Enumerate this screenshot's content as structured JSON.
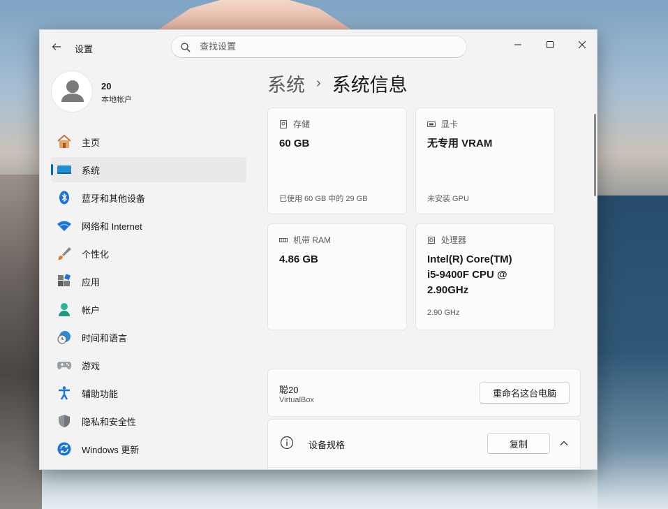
{
  "window": {
    "title": "设置",
    "search_placeholder": "查找设置"
  },
  "profile": {
    "name": "20",
    "account_type": "本地帐户"
  },
  "nav": [
    {
      "label": "主页",
      "icon": "home-icon",
      "active": false
    },
    {
      "label": "系统",
      "icon": "system-icon",
      "active": true
    },
    {
      "label": "蓝牙和其他设备",
      "icon": "bluetooth-icon",
      "active": false
    },
    {
      "label": "网络和 Internet",
      "icon": "wifi-icon",
      "active": false
    },
    {
      "label": "个性化",
      "icon": "brush-icon",
      "active": false
    },
    {
      "label": "应用",
      "icon": "apps-icon",
      "active": false
    },
    {
      "label": "帐户",
      "icon": "account-icon",
      "active": false
    },
    {
      "label": "时间和语言",
      "icon": "globe-clock-icon",
      "active": false
    },
    {
      "label": "游戏",
      "icon": "gamepad-icon",
      "active": false
    },
    {
      "label": "辅助功能",
      "icon": "accessibility-icon",
      "active": false
    },
    {
      "label": "隐私和安全性",
      "icon": "shield-icon",
      "active": false
    },
    {
      "label": "Windows 更新",
      "icon": "update-icon",
      "active": false
    }
  ],
  "breadcrumb": {
    "parent": "系统",
    "separator": "›",
    "current": "系统信息"
  },
  "cards": {
    "storage": {
      "title": "存储",
      "value": "60 GB",
      "footer": "已使用 60 GB 中的 29 GB"
    },
    "gpu": {
      "title": "显卡",
      "value": "无专用 VRAM",
      "footer": "未安装 GPU"
    },
    "ram": {
      "title": "机带 RAM",
      "value": "4.86 GB"
    },
    "cpu": {
      "title": "处理器",
      "value_line1": "Intel(R) Core(TM)",
      "value_line2": "i5-9400F CPU @",
      "value_line3": "2.90GHz",
      "footer": "2.90 GHz"
    }
  },
  "pc": {
    "name": "聪20",
    "model": "VirtualBox",
    "rename_label": "重命名这台电脑"
  },
  "specs": {
    "title": "设备规格",
    "copy_label": "复制"
  },
  "colors": {
    "accent": "#0067c0",
    "window_bg": "#f3f3f3",
    "card_bg": "#fbfbfb"
  }
}
